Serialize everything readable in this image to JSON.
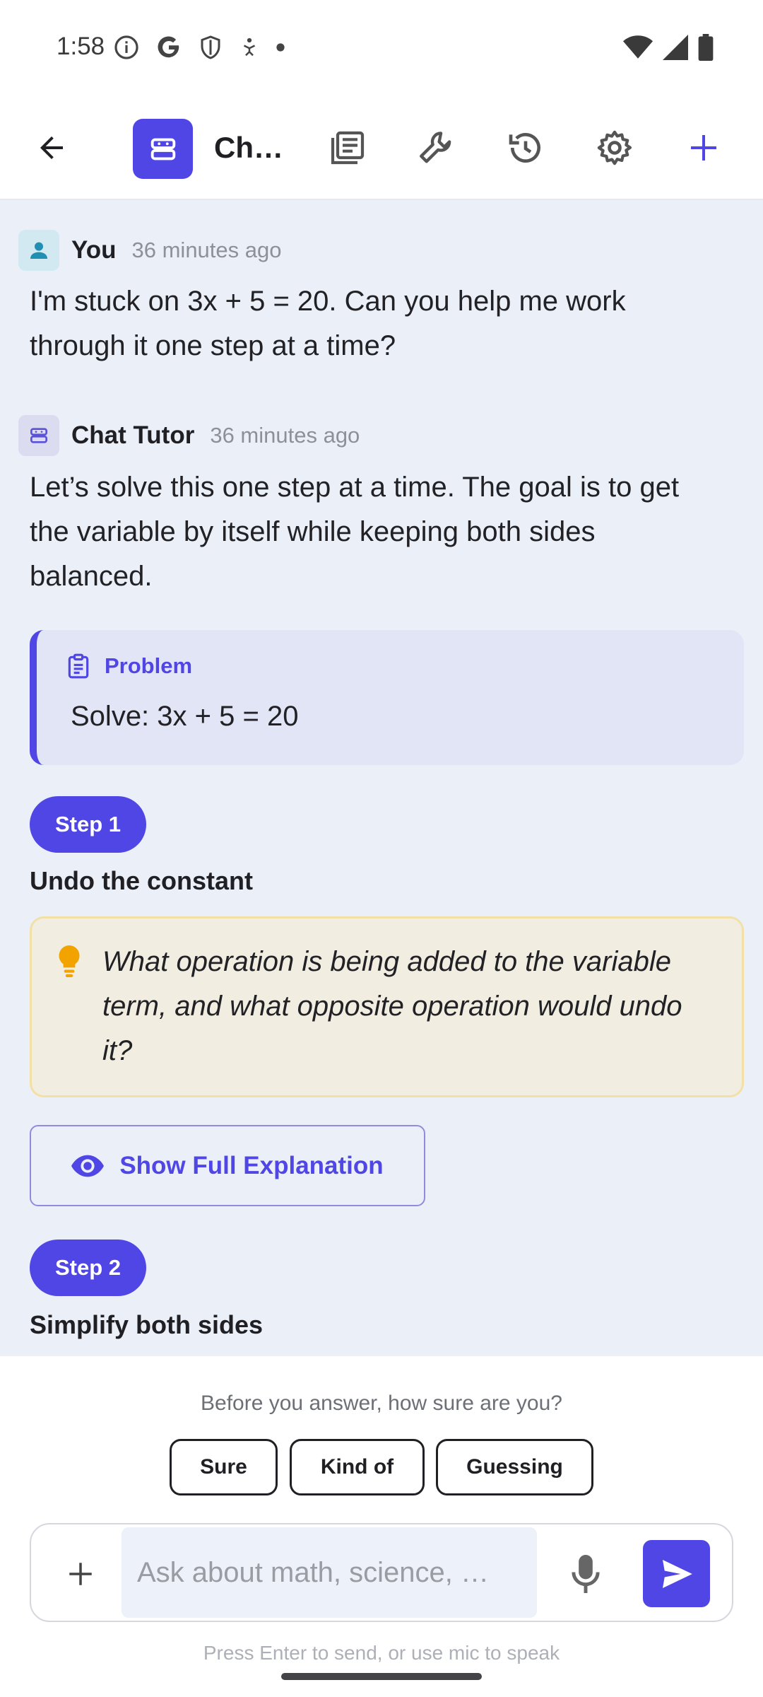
{
  "status_bar": {
    "time": "1:58",
    "left_icons": [
      "info-icon",
      "google-icon",
      "shield-icon",
      "accessibility-icon",
      "dot-icon"
    ],
    "right_icons": [
      "wifi-icon",
      "signal-icon",
      "battery-icon"
    ]
  },
  "app_bar": {
    "title": "Ch…",
    "icons": [
      "back-arrow-icon",
      "robot-icon",
      "notes-icon",
      "wrench-icon",
      "history-icon",
      "gear-icon",
      "plus-icon"
    ],
    "accent": "#4f46e5"
  },
  "messages": [
    {
      "sender": "You",
      "time": "36 minutes ago",
      "avatar_icon": "person-icon",
      "lines": [
        "I'm stuck on 3x + 5 = 20. Can you help me work",
        "through it one step at a time?"
      ]
    },
    {
      "sender": "Chat Tutor",
      "time": "36 minutes ago",
      "avatar_icon": "robot-icon",
      "lines": [
        "Let’s solve this one step at a time. The goal is to get",
        "the variable by itself while keeping both sides",
        "balanced."
      ]
    }
  ],
  "problem": {
    "label": "Problem",
    "icon": "clipboard-icon",
    "text": "Solve: 3x + 5 = 20"
  },
  "steps": [
    {
      "chip": "Step 1",
      "title": "Undo the constant",
      "hint_icon": "lightbulb-icon",
      "hint_lines": [
        "What operation is being added to the variable",
        "term, and what opposite operation would undo",
        "it?"
      ],
      "button": "Show Full Explanation",
      "button_icon": "eye-icon"
    },
    {
      "chip": "Step 2",
      "title": "Simplify both sides"
    }
  ],
  "confidence": {
    "prompt": "Before you answer, how sure are you?",
    "options": [
      "Sure",
      "Kind of",
      "Guessing"
    ]
  },
  "composer": {
    "placeholder": "Ask about math, science, …",
    "footer": "Press Enter to send, or use mic to speak",
    "icons": [
      "plus-icon",
      "mic-icon",
      "send-icon"
    ]
  }
}
